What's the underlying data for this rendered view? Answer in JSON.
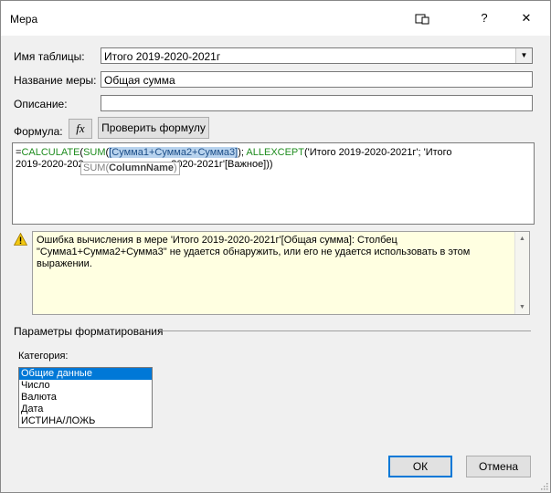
{
  "window": {
    "title": "Мера",
    "help": "?",
    "close": "✕"
  },
  "table_name": {
    "label": "Имя таблицы:",
    "value": "Итого 2019-2020-2021г"
  },
  "measure_name": {
    "label": "Название меры:",
    "value": "Общая сумма"
  },
  "description": {
    "label": "Описание:",
    "value": ""
  },
  "formula": {
    "label": "Формула:",
    "fx_label": "fx",
    "check_button": "Проверить формулу",
    "part_eq": "=",
    "fn_calculate": "CALCULATE",
    "paren1": "(",
    "fn_sum": "SUM",
    "paren2": "(",
    "arg_highlight": "[Сумма1+Сумма2+Сумма3]",
    "part_after_sum": "); ",
    "fn_allexcept": "ALLEXCEPT",
    "part_allexcept_args": "('Итого 2019-2020-2021г'; 'Итого",
    "line2_start": "2019-2020-202",
    "line2_end": "-2020-2021г'[Важное]))",
    "tooltip_fn": "SUM(",
    "tooltip_param": "ColumnName",
    "tooltip_close": ")"
  },
  "error": {
    "text": "Ошибка вычисления в мере 'Итого 2019-2020-2021г'[Общая сумма]: Столбец \"Сумма1+Сумма2+Сумма3\" не удается обнаружить, или его не удается использовать в этом выражении."
  },
  "formatting": {
    "group_label": "Параметры форматирования",
    "category_label": "Категория:",
    "categories": [
      "Общие данные",
      "Число",
      "Валюта",
      "Дата",
      "ИСТИНА/ЛОЖЬ"
    ],
    "selected_index": 0
  },
  "buttons": {
    "ok": "ОК",
    "cancel": "Отмена"
  },
  "colors": {
    "accent": "#0078d7",
    "function": "#1e8c1e",
    "warning_bg": "#ffffe1",
    "warning_icon": "#f2c811"
  }
}
